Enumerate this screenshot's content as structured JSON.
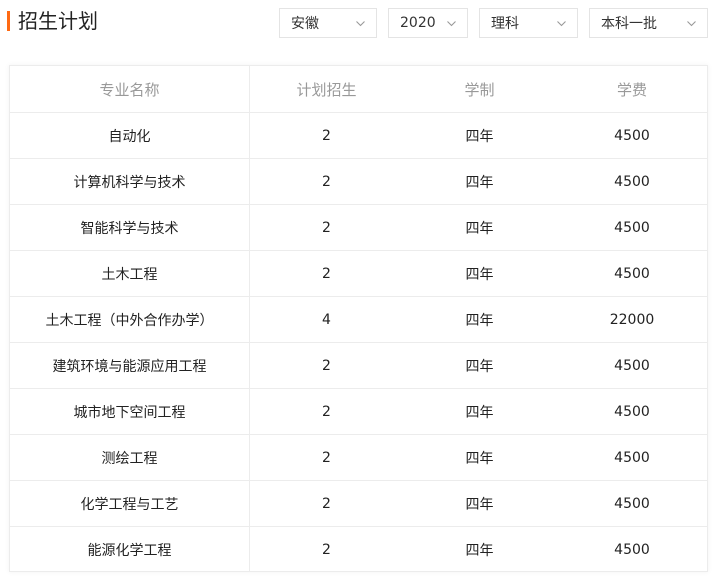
{
  "header": {
    "title": "招生计划",
    "accent_color": "#ff6a13"
  },
  "filters": {
    "province": "安徽",
    "year": "2020",
    "subject": "理科",
    "batch": "本科一批",
    "chevron_icon": "chevron-down-icon"
  },
  "table": {
    "columns": [
      "专业名称",
      "计划招生",
      "学制",
      "学费"
    ],
    "rows": [
      {
        "major": "自动化",
        "plan": "2",
        "years": "四年",
        "fee": "4500"
      },
      {
        "major": "计算机科学与技术",
        "plan": "2",
        "years": "四年",
        "fee": "4500"
      },
      {
        "major": "智能科学与技术",
        "plan": "2",
        "years": "四年",
        "fee": "4500"
      },
      {
        "major": "土木工程",
        "plan": "2",
        "years": "四年",
        "fee": "4500"
      },
      {
        "major": "土木工程（中外合作办学）",
        "plan": "4",
        "years": "四年",
        "fee": "22000"
      },
      {
        "major": "建筑环境与能源应用工程",
        "plan": "2",
        "years": "四年",
        "fee": "4500"
      },
      {
        "major": "城市地下空间工程",
        "plan": "2",
        "years": "四年",
        "fee": "4500"
      },
      {
        "major": "测绘工程",
        "plan": "2",
        "years": "四年",
        "fee": "4500"
      },
      {
        "major": "化学工程与工艺",
        "plan": "2",
        "years": "四年",
        "fee": "4500"
      },
      {
        "major": "能源化学工程",
        "plan": "2",
        "years": "四年",
        "fee": "4500"
      }
    ]
  }
}
